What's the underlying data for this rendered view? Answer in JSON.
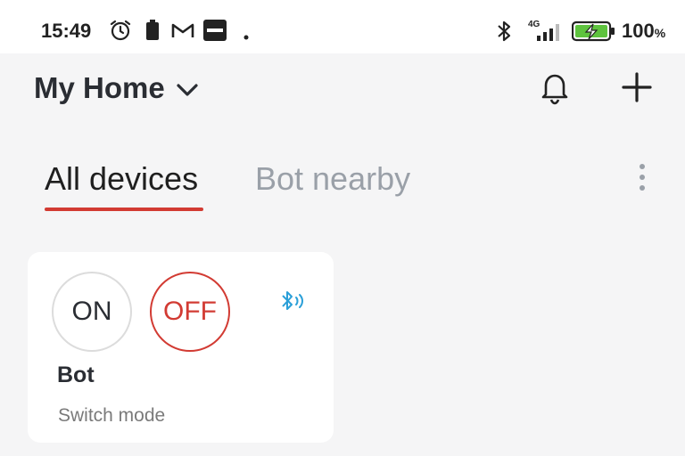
{
  "status_bar": {
    "time": "15:49",
    "network": "4G",
    "battery_value": "100",
    "battery_unit": "%",
    "icons": [
      "alarm-icon",
      "battery-saver-icon",
      "gmail-icon",
      "ifttt-icon",
      "dot-icon",
      "bluetooth-icon",
      "signal-icon",
      "battery-charging-icon"
    ]
  },
  "header": {
    "title": "My Home",
    "actions": [
      "bell-icon",
      "plus-icon"
    ]
  },
  "tabs": [
    {
      "label": "All devices",
      "active": true
    },
    {
      "label": "Bot nearby",
      "active": false
    }
  ],
  "device_card": {
    "on_label": "ON",
    "off_label": "OFF",
    "name": "Bot",
    "mode": "Switch mode"
  },
  "colors": {
    "accent": "#d23b33",
    "bluetooth_indicator": "#2a9fd8",
    "background": "#f5f5f6"
  }
}
